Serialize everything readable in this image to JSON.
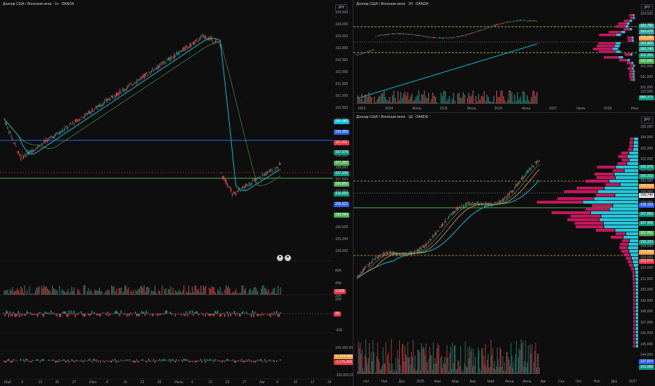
{
  "left": {
    "title": "Доллар США / Японская иена · 1ч · OANDA",
    "currency": "JPY",
    "price_ticks": [
      "164,500",
      "164,000",
      "163,500",
      "163,000",
      "162,500",
      "162,000",
      "161,500",
      "161,000",
      "160,500",
      "160,000",
      "159,500",
      "159,000",
      "158,500",
      "158,000",
      "157,500",
      "157,000",
      "156,500",
      "156,000",
      "155,500",
      "155,000",
      "154,500"
    ],
    "price_tags": [
      {
        "text": "160,080",
        "color": "#00bcd4"
      },
      {
        "text": "159,000",
        "color": "#2962ff"
      },
      {
        "text": "157,911",
        "color": "#f23645"
      },
      {
        "text": "157,676",
        "color": "#089981"
      },
      {
        "text": "157,297",
        "color": "#4caf50"
      },
      {
        "text": "157,026",
        "color": "#089981"
      },
      {
        "text": "156,852",
        "color": "#4caf50"
      },
      {
        "text": "156,650",
        "color": "#089981"
      },
      {
        "text": "156,521",
        "color": "#2962ff"
      },
      {
        "text": "156,094",
        "color": "#4caf50"
      }
    ],
    "time_ticks": [
      "Май",
      "6",
      "13",
      "20",
      "27",
      "Июн",
      "8",
      "15",
      "22",
      "29",
      "Июль",
      "6",
      "13",
      "20",
      "27",
      "Авг",
      "6",
      "10",
      "17",
      "24"
    ],
    "vol_ticks": [
      "80K",
      "40K",
      "20K"
    ],
    "vol_tag": "3,068",
    "osc_ticks": [
      "20K",
      "-20K"
    ],
    "osc_tag": "39",
    "flow_ticks": [
      "100,000,000",
      "-100,000,000"
    ],
    "flow_tags": [
      "17,876,000",
      "-3,175,000"
    ]
  },
  "right_top": {
    "title": "Доллар США / Японская иена · 1Н · OANDA",
    "currency": "JPY",
    "price_ticks": [
      "164,500",
      "164,000",
      "163,500",
      "163,000",
      "162,500",
      "162,000",
      "161,500",
      "161,000",
      "160,500"
    ],
    "price_tags": [
      {
        "text": "163,796",
        "color": "#26a69a"
      },
      {
        "text": "163,478",
        "color": "#26a69a"
      },
      {
        "text": "163,040",
        "color": "#f59e3b"
      },
      {
        "text": "162,962",
        "color": "#26a69a"
      },
      {
        "text": "162,740",
        "color": "#26a69a"
      },
      {
        "text": "162,350",
        "color": "#089981"
      },
      {
        "text": "162,000",
        "color": "#4caf50"
      }
    ],
    "vol_ticks": [
      "120,000"
    ],
    "vol_tag": "889,371",
    "time_ticks": [
      "2023",
      "2024",
      "Июль",
      "2025",
      "Июль",
      "2026",
      "Июль",
      "2027",
      "Июль",
      "2028",
      "Июль"
    ]
  },
  "right_bottom": {
    "title": "Доллар США / Японская иена · 1Д · OANDA",
    "currency": "JPY",
    "price_ticks": [
      "165,000",
      "164,000",
      "163,000",
      "162,000",
      "161,000",
      "160,000",
      "159,000",
      "158,000",
      "157,000",
      "156,000",
      "155,000",
      "154,000",
      "153,000",
      "152,000",
      "151,000",
      "150,000",
      "149,000",
      "148,000",
      "147,000",
      "146,000",
      "145,000",
      "144,000"
    ],
    "price_tags": [
      {
        "text": "160,975",
        "color": "#089981"
      },
      {
        "text": "160,233",
        "color": "#089981"
      },
      {
        "text": "159,512",
        "color": "#f59e3b"
      },
      {
        "text": "158,740",
        "color": "#e0e3eb"
      },
      {
        "text": "158,133",
        "color": "#2962ff"
      },
      {
        "text": "157,850",
        "color": "#089981"
      },
      {
        "text": "157,455",
        "color": "#089981"
      },
      {
        "text": "157,051",
        "color": "#4caf50"
      },
      {
        "text": "155,323",
        "color": "#089981"
      },
      {
        "text": "153,800",
        "color": "#f59e3b"
      },
      {
        "text": "153,076",
        "color": "#f23645"
      }
    ],
    "vol_tags": [
      "137,814",
      "163,088"
    ],
    "time_ticks": [
      "Окт",
      "Ноя",
      "Дек",
      "2026",
      "Фев",
      "Мар",
      "Апр",
      "Май",
      "Июнь",
      "Июль",
      "Авг",
      "Сен",
      "Окт",
      "Ноя",
      "Дек",
      "2027"
    ]
  },
  "icons": [
    "flag-icon",
    "flag-icon"
  ],
  "colors": {
    "up": "#26a69a",
    "down": "#ef5350",
    "bg": "#0e0e0e",
    "ema_cyan": "#00bcd4",
    "level_green": "#4caf50",
    "level_blue": "#2962ff",
    "level_orange": "#f59e3b",
    "profile_pink": "#c2185b",
    "profile_cyan": "#26c6da"
  }
}
